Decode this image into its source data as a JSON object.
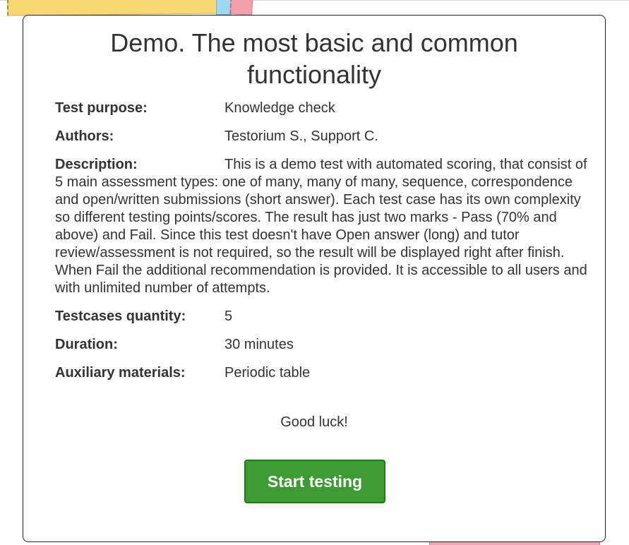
{
  "card": {
    "title": "Demo. The most basic and common functionality"
  },
  "info": {
    "purpose_label": "Test purpose:",
    "purpose_value": "Knowledge check",
    "authors_label": "Authors:",
    "authors_value": "Testorium S., Support C.",
    "description_label": "Description:",
    "description_value": "This is a demo test with automated scoring, that consist of 5 main assessment types: one of many, many of many, sequence, correspondence and open/written submissions (short answer). Each test case has its own complexity so different testing points/scores. The result has just two marks - Pass (70% and above) and Fail. Since this test doesn't have Open answer (long) and tutor review/assessment is not required, so the result will be displayed right after finish. When Fail the additional recommendation is provided. It is accessible to all users and with unlimited number of attempts.",
    "testcases_label": "Testcases quantity:",
    "testcases_value": "5",
    "duration_label": "Duration:",
    "duration_value": "30 minutes",
    "materials_label": "Auxiliary materials:",
    "materials_value": "Periodic table"
  },
  "greeting": "Good luck!",
  "start_button_label": "Start testing",
  "colors": {
    "button_green": "#3e9a33",
    "button_border": "#1f7a15",
    "tab_yellow": "#f7d873",
    "tab_blue": "#9fd8f3",
    "tab_pink": "#f1a0ad"
  }
}
